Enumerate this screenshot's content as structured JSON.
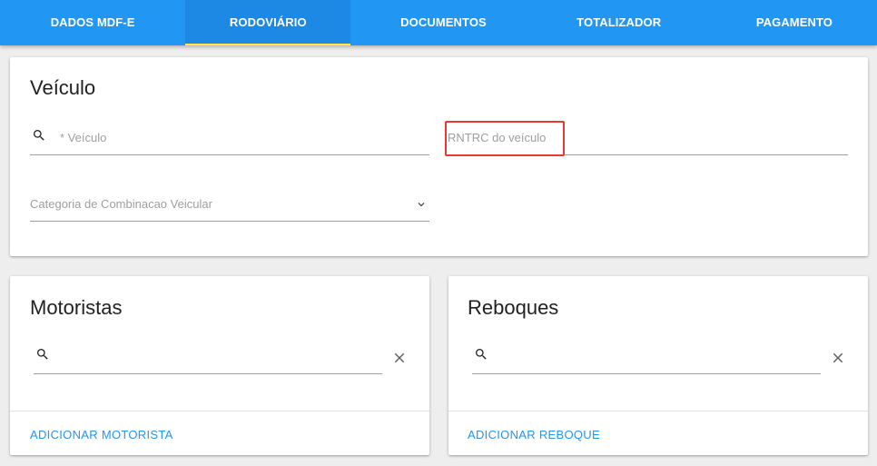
{
  "tabs": [
    {
      "label": "DADOS MDF-E"
    },
    {
      "label": "RODOVIÁRIO"
    },
    {
      "label": "DOCUMENTOS"
    },
    {
      "label": "TOTALIZADOR"
    },
    {
      "label": "PAGAMENTO"
    }
  ],
  "active_tab": "RODOVIÁRIO",
  "veiculo": {
    "title": "Veículo",
    "veiculo_placeholder": "* Veículo",
    "rntrc_placeholder": "RNTRC do veículo",
    "categoria_placeholder": "Categoria de Combinacao Veicular"
  },
  "motoristas": {
    "title": "Motoristas",
    "action_label": "ADICIONAR MOTORISTA"
  },
  "reboques": {
    "title": "Reboques",
    "action_label": "ADICIONAR REBOQUE"
  },
  "colors": {
    "primary": "#2196f3",
    "tab_active_indicator": "#ffeb3b",
    "highlight": "#e53935"
  },
  "icons": {
    "search": "search-icon",
    "close": "close-icon",
    "dropdown": "chevron-down-icon"
  }
}
